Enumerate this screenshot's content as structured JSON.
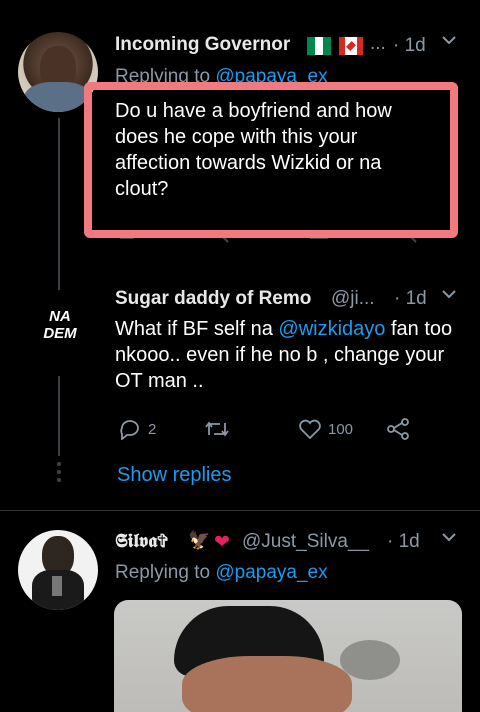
{
  "tweet1": {
    "display_name": "Incoming Governor",
    "flags": [
      "nigeria-flag-icon",
      "canada-flag-icon"
    ],
    "ellipsis": "...",
    "time": "· 1d",
    "replying_prefix": "Replying to ",
    "replying_handle": "@papaya_ex",
    "text": "Do u have a boyfriend and how does he cope with this your affection towards Wizkid or na clout?"
  },
  "tweet2": {
    "avatar_line1": "NA",
    "avatar_line2": "DEM",
    "display_name": "Sugar daddy of Remo",
    "handle": "@ji...",
    "time": "· 1d",
    "text_before": "What if BF self na ",
    "mention": "@wizkidayo",
    "text_after": " fan too nkooo..  even if he no b , change your OT man ..",
    "reply_count": "2",
    "like_count": "100",
    "show_replies": "Show replies"
  },
  "tweet3": {
    "display_name": "𝕾𝖎𝖑𝖛𝖆✞",
    "name_emojis": [
      "eagle-icon",
      "heart-icon"
    ],
    "handle": "@Just_Silva__",
    "time": "· 1d",
    "replying_prefix": "Replying to ",
    "replying_handle": "@papaya_ex"
  },
  "colors": {
    "background": "#000000",
    "accent": "#1d9bf0",
    "muted": "#8b98a5",
    "highlight_box": "#f07a7d"
  }
}
